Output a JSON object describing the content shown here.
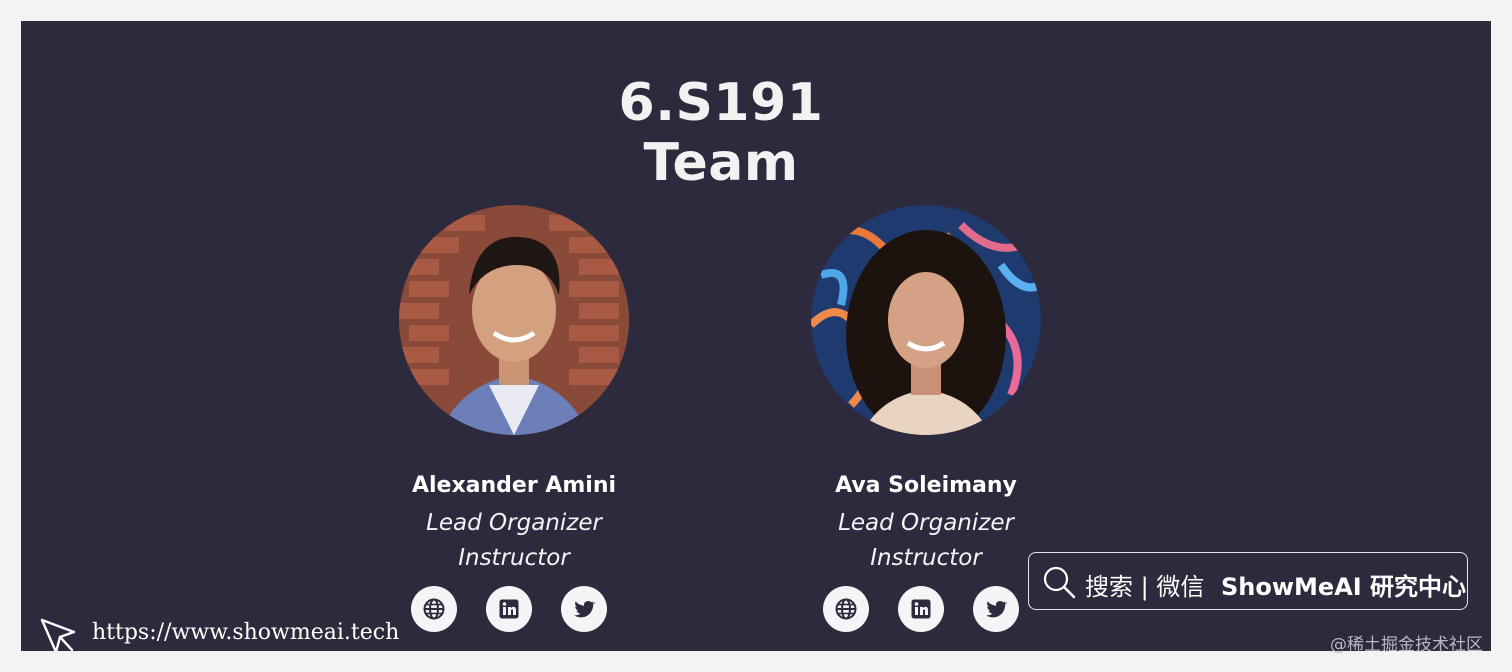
{
  "page": {
    "title": "6.S191 Team"
  },
  "members": [
    {
      "name": "Alexander Amini",
      "roles": [
        "Lead Organizer",
        "Instructor"
      ]
    },
    {
      "name": "Ava Soleimany",
      "roles": [
        "Lead Organizer",
        "Instructor"
      ]
    }
  ],
  "member_icons": [
    "globe-icon",
    "linkedin-icon",
    "twitter-icon"
  ],
  "overlay": {
    "search_text": "搜索 | 微信",
    "brand_text": "ShowMeAI 研究中心",
    "site_url": "https://www.showmeai.tech",
    "watermark": "@稀土掘金技术社区"
  },
  "colors": {
    "panel_bg": "#2d2a3e",
    "page_bg": "#f3f3f3",
    "icon_bg": "#f5f5f8",
    "icon_fg": "#2d2a3e"
  }
}
